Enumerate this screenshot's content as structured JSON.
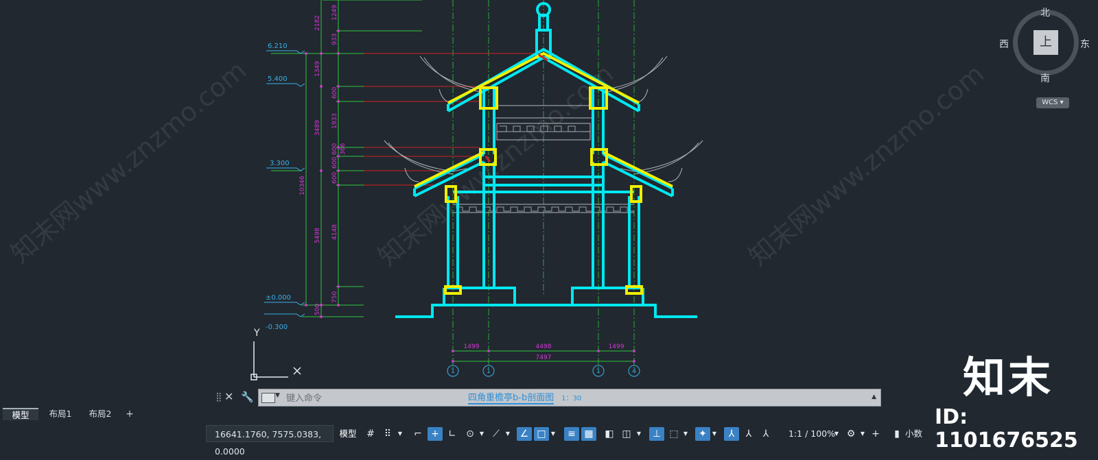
{
  "viewcube": {
    "north": "北",
    "south": "南",
    "west": "西",
    "east": "东",
    "top": "上",
    "wcs": "WCS"
  },
  "dims_left": {
    "levels": [
      "6.210",
      "5.400",
      "3.300",
      "±0.000",
      "-0.300"
    ],
    "outer": "10346",
    "mid": [
      "1349",
      "3489",
      "5498",
      "500"
    ],
    "inner": [
      "2182",
      "1249",
      "933",
      "600",
      "1933",
      "600",
      "366",
      "600",
      "600",
      "4148",
      "750"
    ]
  },
  "dims_bottom": {
    "spans": [
      "1499",
      "4498",
      "1499"
    ],
    "total": "7497",
    "axes": [
      "1",
      "1",
      "1",
      "4"
    ]
  },
  "drawing_title": "四角重檐亭b-b剖面图",
  "drawing_scale": "1：30",
  "ucs": {
    "x": "X",
    "y": "Y"
  },
  "command": {
    "placeholder": "键入命令"
  },
  "tabs": [
    "模型",
    "布局1",
    "布局2"
  ],
  "status": {
    "coords": "16641.1760, 7575.0383, 0.0000",
    "model": "模型",
    "scale": "1:1 / 100%",
    "units": "小数"
  },
  "watermark": {
    "brand": "知末",
    "id": "ID: 1101676525",
    "diag": "知末网www.znzmo.com"
  }
}
